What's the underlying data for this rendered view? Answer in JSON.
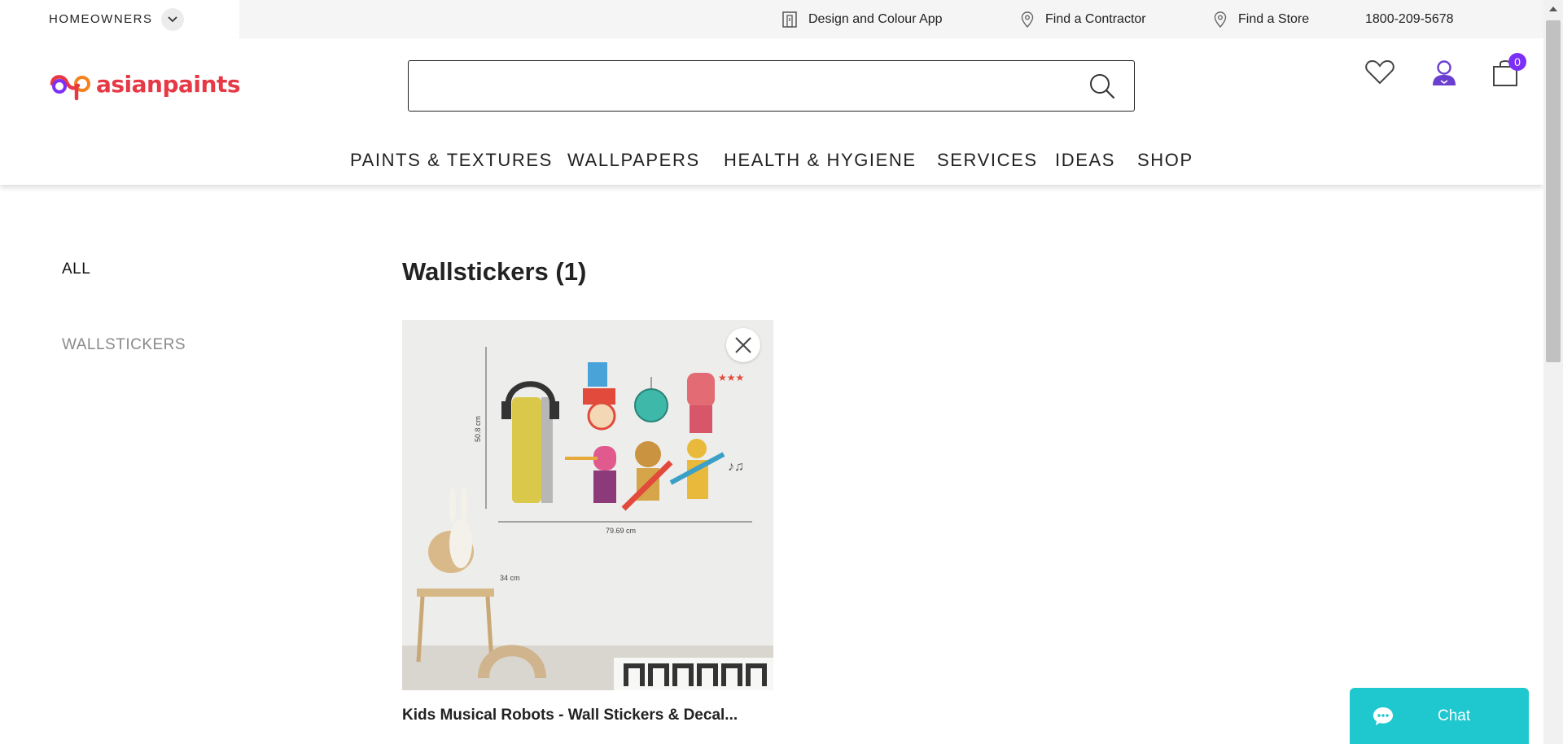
{
  "topbar": {
    "audience": "HOMEOWNERS",
    "links": [
      {
        "label": "Design and Colour App",
        "icon": "building-icon"
      },
      {
        "label": "Find a Contractor",
        "icon": "location-pin-icon"
      },
      {
        "label": "Find a Store",
        "icon": "location-pin-icon"
      }
    ],
    "phone": "1800-209-5678"
  },
  "header": {
    "logo_text": "asianpaints",
    "search": {
      "value": "",
      "placeholder": ""
    },
    "cart_count": "0"
  },
  "nav": {
    "items": [
      "PAINTS & TEXTURES",
      "WALLPAPERS",
      "HEALTH & HYGIENE",
      "SERVICES",
      "IDEAS",
      "SHOP"
    ]
  },
  "sidebar": {
    "items": [
      "ALL",
      "WALLSTICKERS"
    ]
  },
  "main": {
    "title": "Wallstickers (1)",
    "products": [
      {
        "name": "Kids Musical Robots - Wall Stickers & Decal...",
        "image_labels": {
          "height": "50.8 cm",
          "width": "79.69 cm",
          "side": "34 cm"
        }
      }
    ]
  },
  "chat": {
    "label": "Chat"
  },
  "colors": {
    "brand_red": "#e63946",
    "brand_purple": "#7b2ff7",
    "chat_teal": "#1fc7cf",
    "user_icon": "#6a3fd0"
  }
}
